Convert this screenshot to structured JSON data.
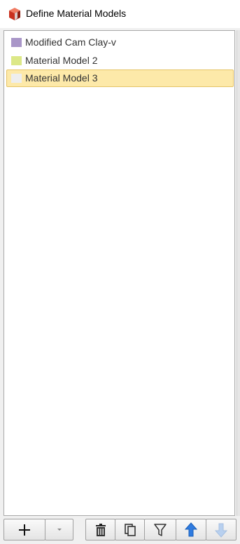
{
  "window": {
    "title": "Define Material Models",
    "icon": "material-cube-icon"
  },
  "materials": [
    {
      "name": "Modified Cam Clay-v",
      "color": "#a996c8"
    },
    {
      "name": "Material Model 2",
      "color": "#dce887"
    },
    {
      "name": "Material Model 3",
      "color": "#eeeeee",
      "selected": true
    }
  ],
  "toolbar": {
    "buttons": [
      {
        "name": "add-material-button",
        "icon": "plus-icon"
      },
      {
        "name": "add-dropdown-button",
        "icon": "dropdown-arrow-icon"
      },
      {
        "name": "delete-button",
        "icon": "trash-icon"
      },
      {
        "name": "copy-button",
        "icon": "copy-icon"
      },
      {
        "name": "filter-button",
        "icon": "filter-icon"
      },
      {
        "name": "move-up-button",
        "icon": "arrow-up-icon"
      },
      {
        "name": "move-down-button",
        "icon": "arrow-down-icon",
        "disabled": true
      }
    ]
  }
}
